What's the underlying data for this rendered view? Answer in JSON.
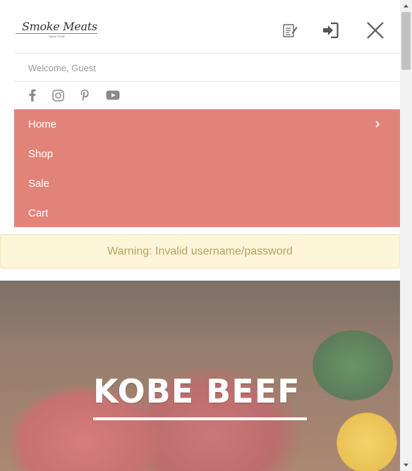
{
  "header": {
    "logo_text": "Smoke Meats",
    "logo_sub": "Since 1924"
  },
  "icons": {
    "register": "register-icon",
    "login": "login-icon",
    "close": "close-icon"
  },
  "welcome": {
    "text": "Welcome, Guest"
  },
  "social": [
    "facebook-icon",
    "instagram-icon",
    "pinterest-icon",
    "youtube-icon"
  ],
  "menu": {
    "items": [
      {
        "label": "Home",
        "has_children": true
      },
      {
        "label": "Shop"
      },
      {
        "label": "Sale"
      },
      {
        "label": "Cart"
      }
    ]
  },
  "alert": {
    "text": "Warning: Invalid username/password"
  },
  "hero": {
    "title": "KOBE BEEF"
  },
  "colors": {
    "menu_bg": "#e2837a",
    "warning_bg": "#fcf5d8",
    "warning_text": "#b4a266"
  }
}
